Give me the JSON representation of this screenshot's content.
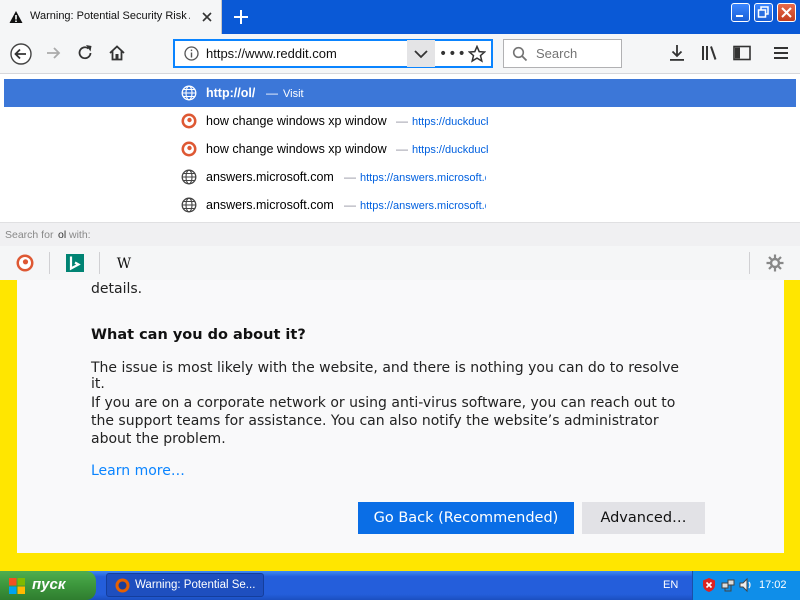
{
  "tab": {
    "title": "Warning: Potential Security Risk Ahead",
    "icon": "warning-icon"
  },
  "navbar": {
    "url": "https://www.reddit.com",
    "search_placeholder": "Search",
    "url_dots": "•••"
  },
  "dropdown": {
    "rows": [
      {
        "title": "http://ol/",
        "sep": "—",
        "url": "Visit",
        "icon": "globe-icon"
      },
      {
        "title": "how change windows xp window",
        "sep": "—",
        "url": "https://duckduckgo.com",
        "icon": "duckduckgo-icon"
      },
      {
        "title": "how change windows xp window",
        "sep": "—",
        "url": "https://duckduckgo.com",
        "icon": "duckduckgo-icon"
      },
      {
        "title": "answers.microsoft.com",
        "sep": "—",
        "url": "https://answers.microsoft.com",
        "icon": "globe-icon"
      },
      {
        "title": "answers.microsoft.com",
        "sep": "—",
        "url": "https://answers.microsoft.com",
        "icon": "globe-icon"
      }
    ],
    "search_for_prefix": "Search for ",
    "search_for_term": "ol",
    "search_for_suffix": " with:"
  },
  "page": {
    "details": "details.",
    "heading": "What can you do about it?",
    "p1": "The issue is most likely with the website, and there is nothing you can do to resolve it.",
    "p2": "If you are on a corporate network or using anti-virus software, you can reach out to the support teams for assistance. You can also notify the website’s administrator about the problem.",
    "learn_more": "Learn more…",
    "go_back": "Go Back (Recommended)",
    "advanced": "Advanced…"
  },
  "taskbar": {
    "start": "пуск",
    "task_item": "Warning: Potential Se...",
    "lang": "EN",
    "clock": "17:02"
  },
  "colors": {
    "accent": "#0a84ff",
    "selection": "#3c77d8",
    "xp_blue": "#245edb",
    "page_border": "#ffe600"
  }
}
